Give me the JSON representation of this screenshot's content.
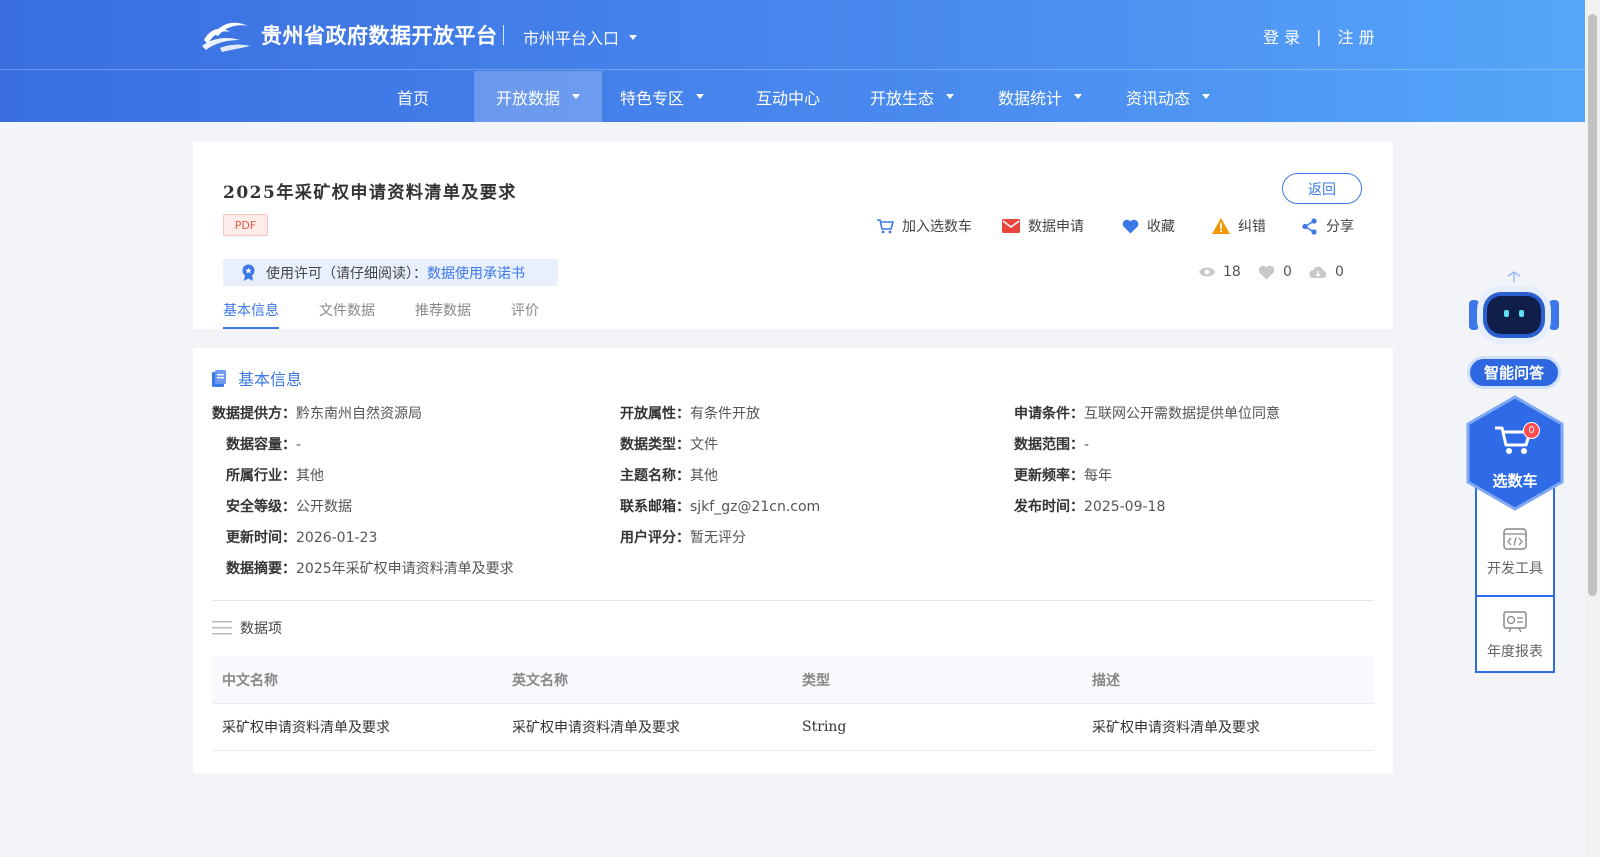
{
  "header": {
    "site_title": "贵州省政府数据开放平台",
    "city_entry": "市州平台入口",
    "login": "登 录",
    "divider": "|",
    "register": "注 册"
  },
  "nav": {
    "items": [
      {
        "label": "首页",
        "has_dropdown": false,
        "active": false
      },
      {
        "label": "开放数据",
        "has_dropdown": true,
        "active": true
      },
      {
        "label": "特色专区",
        "has_dropdown": true,
        "active": false
      },
      {
        "label": "互动中心",
        "has_dropdown": false,
        "active": false
      },
      {
        "label": "开放生态",
        "has_dropdown": true,
        "active": false
      },
      {
        "label": "数据统计",
        "has_dropdown": true,
        "active": false
      },
      {
        "label": "资讯动态",
        "has_dropdown": true,
        "active": false
      }
    ]
  },
  "dataset": {
    "title": "2025年采矿权申请资料清单及要求",
    "format_badge": "PDF",
    "back_label": "返回",
    "actions": {
      "add_cart": "加入选数车",
      "apply": "数据申请",
      "favorite": "收藏",
      "report_error": "纠错",
      "share": "分享"
    },
    "license_prefix": "使用许可（请仔细阅读）：",
    "license_link": "数据使用承诺书",
    "stats": {
      "views": "18",
      "likes": "0",
      "downloads": "0"
    },
    "tabs": [
      "基本信息",
      "文件数据",
      "推荐数据",
      "评价"
    ]
  },
  "basic_info": {
    "section_title": "基本信息",
    "provider_label": "数据提供方：",
    "provider": "黔东南州自然资源局",
    "open_attr_label": "开放属性：",
    "open_attr": "有条件开放",
    "apply_cond_label": "申请条件：",
    "apply_cond": "互联网公开需数据提供单位同意",
    "capacity_label": "数据容量：",
    "capacity": "-",
    "data_type_label": "数据类型：",
    "data_type": "文件",
    "scope_label": "数据范围：",
    "scope": "-",
    "industry_label": "所属行业：",
    "industry": "其他",
    "topic_label": "主题名称：",
    "topic": "其他",
    "frequency_label": "更新频率：",
    "frequency": "每年",
    "security_label": "安全等级：",
    "security": "公开数据",
    "email_label": "联系邮箱：",
    "email": "sjkf_gz@21cn.com",
    "publish_label": "发布时间：",
    "publish": "2025-09-18",
    "update_label": "更新时间：",
    "update": "2026-01-23",
    "rating_label": "用户评分：",
    "rating": "暂无评分",
    "summary_label": "数据摘要：",
    "summary": "2025年采矿权申请资料清单及要求"
  },
  "data_items": {
    "title": "数据项",
    "columns": [
      "中文名称",
      "英文名称",
      "类型",
      "描述"
    ],
    "rows": [
      [
        "采矿权申请资料清单及要求",
        "采矿权申请资料清单及要求",
        "String",
        "采矿权申请资料清单及要求"
      ]
    ]
  },
  "side": {
    "ai_label": "智能问答",
    "cart_label": "选数车",
    "cart_count": "0",
    "dev_tools": "开发工具",
    "annual_report": "年度报表"
  },
  "colors": {
    "brand": "#3c78e8",
    "header_start": "#3a6ee0",
    "header_end": "#56a6fa",
    "error_orange": "#f39800",
    "apply_red": "#e8463a"
  },
  "icons": [
    "logo-icon",
    "cart-icon",
    "mail-icon",
    "heart-icon",
    "warning-icon",
    "share-icon",
    "license-badge-icon",
    "eye-icon",
    "cloud-download-icon",
    "document-icon",
    "list-icon",
    "code-icon",
    "report-icon",
    "robot-icon"
  ]
}
